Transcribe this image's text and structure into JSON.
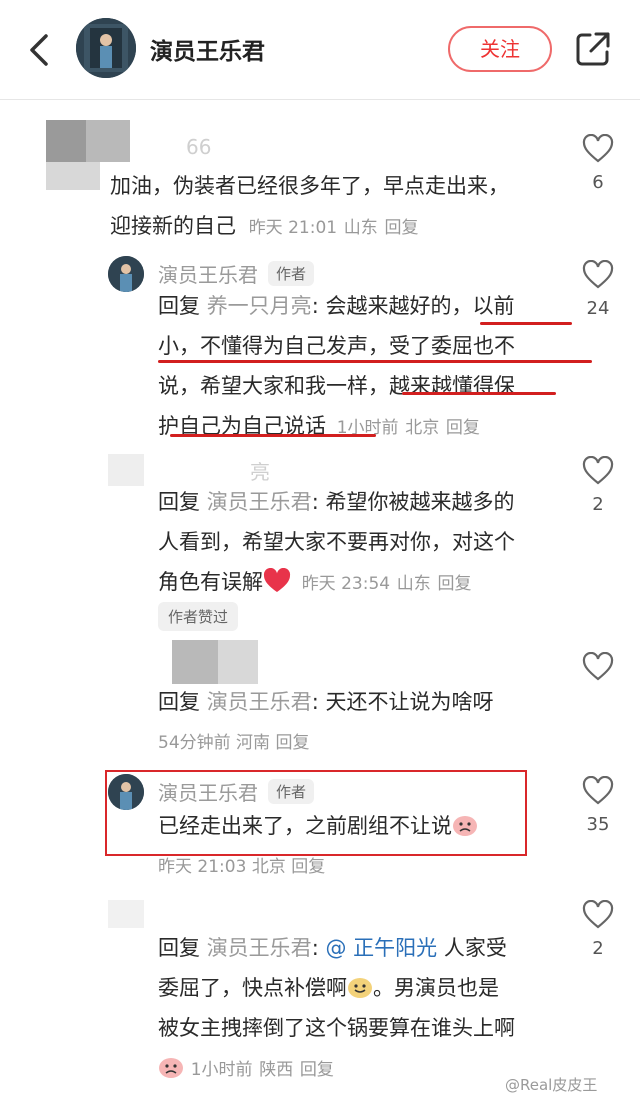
{
  "header": {
    "title": "演员王乐君",
    "follow_label": "关注"
  },
  "comments": [
    {
      "user_partial": "66",
      "text_line1": "加油，伪装者已经很多年了，早点走出来，",
      "text_line2": "迎接新的自己",
      "time": "昨天 21:01",
      "location": "山东",
      "reply": "回复",
      "likes": "6"
    },
    {
      "name": "演员王乐君",
      "author_tag": "作者",
      "reply_prefix": "回复",
      "reply_target": "养一只月亮",
      "line1": "会越来越好的，以前",
      "line2": "小，不懂得为自己发声，受了委屈也不",
      "line3": "说，希望大家和我一样，越来越懂得保",
      "line4": "护自己为自己说话",
      "time": "1小时前",
      "location": "北京",
      "reply": "回复",
      "likes": "24"
    },
    {
      "user_partial": "亮",
      "reply_prefix": "回复",
      "reply_target": "演员王乐君",
      "line1": "希望你被越来越多的",
      "line2": "人看到，希望大家不要再对你，对这个",
      "line3": "角色有误解",
      "time": "昨天 23:54",
      "location": "山东",
      "reply": "回复",
      "likes": "2",
      "liked_by_author": "作者赞过"
    },
    {
      "reply_prefix": "回复",
      "reply_target": "演员王乐君",
      "line1": "天还不让说为啥呀",
      "time": "54分钟前",
      "location": "河南",
      "reply": "回复"
    },
    {
      "name": "演员王乐君",
      "author_tag": "作者",
      "line1": "已经走出来了，之前剧组不让说",
      "time": "昨天 21:03",
      "location": "北京",
      "reply": "回复",
      "likes": "35"
    },
    {
      "reply_prefix": "回复",
      "reply_target": "演员王乐君",
      "mention": "@ 正午阳光",
      "line1_tail": "人家受",
      "line2": "委屈了，快点补偿啊",
      "line2_tail": "。男演员也是",
      "line3": "被女主拽摔倒了这个锅要算在谁头上啊",
      "time": "1小时前",
      "location": "陕西",
      "reply": "回复",
      "likes": "2"
    }
  ],
  "watermark": "@Real皮皮王",
  "colors": {
    "accent_red": "#e33333",
    "annotation_red": "#d21f1f",
    "mention_blue": "#2a6fb8",
    "muted_text": "#999999"
  },
  "icons": [
    "back-arrow-icon",
    "share-icon",
    "heart-outline-icon",
    "red-heart-emoji",
    "sad-face-emoji",
    "smile-face-emoji"
  ]
}
